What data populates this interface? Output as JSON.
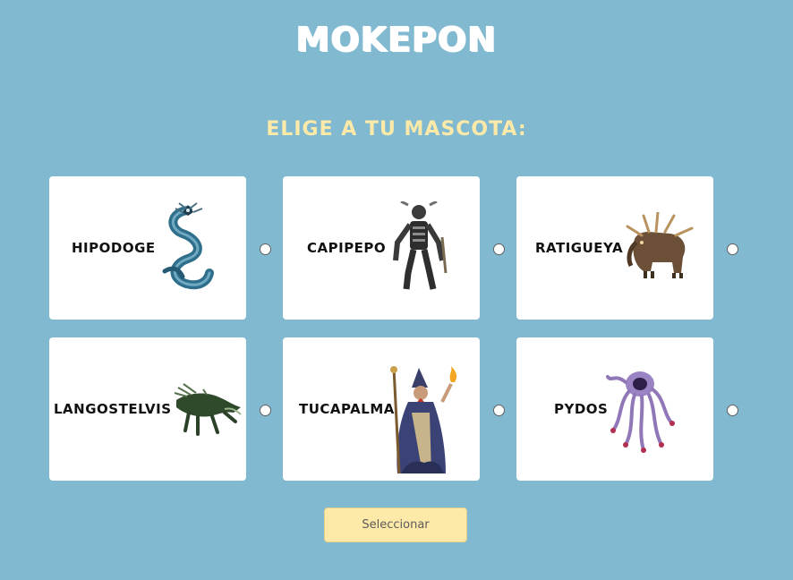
{
  "header": {
    "title": "MOKEPON"
  },
  "selection": {
    "prompt": "ELIGE A TU MASCOTA:"
  },
  "pets": [
    {
      "name": "HIPODOGE",
      "art": "serpent-dragon-icon",
      "selected": false
    },
    {
      "name": "CAPIPEPO",
      "art": "skeleton-warrior-icon",
      "selected": false
    },
    {
      "name": "RATIGUEYA",
      "art": "horned-beast-icon",
      "selected": false
    },
    {
      "name": "LANGOSTELVIS",
      "art": "sea-crawler-icon",
      "selected": false
    },
    {
      "name": "TUCAPALMA",
      "art": "wizard-icon",
      "selected": false
    },
    {
      "name": "PYDOS",
      "art": "tentacle-creature-icon",
      "selected": false
    }
  ],
  "actions": {
    "select_label": "Seleccionar"
  },
  "colors": {
    "background": "#81b9d1",
    "title": "#ffffff",
    "accent": "#fde9a8",
    "card": "#ffffff"
  }
}
